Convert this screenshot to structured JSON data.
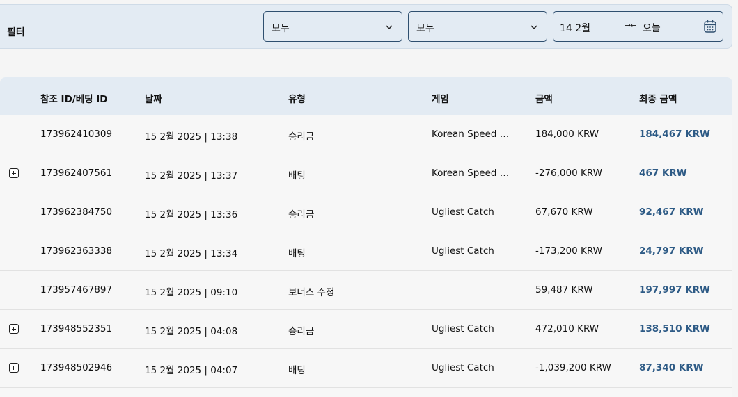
{
  "filter": {
    "title": "필터",
    "select1": "모두",
    "select2": "모두",
    "date_from": "14 2월",
    "date_arrows": "→←",
    "date_to": "오늘"
  },
  "table": {
    "headers": [
      "참조 ID/베팅 ID",
      "날짜",
      "유형",
      "게임",
      "금액",
      "최종 금액"
    ],
    "rows": [
      {
        "expandable": false,
        "ref_id": "173962410309",
        "date": "15 2월 2025 | 13:38",
        "type": "승리금",
        "game": "Korean Speed …",
        "amount": "184,000 KRW",
        "final": "184,467 KRW"
      },
      {
        "expandable": true,
        "ref_id": "173962407561",
        "date": "15 2월 2025 | 13:37",
        "type": "배팅",
        "game": "Korean Speed …",
        "amount": "-276,000 KRW",
        "final": "467 KRW"
      },
      {
        "expandable": false,
        "ref_id": "173962384750",
        "date": "15 2월 2025 | 13:36",
        "type": "승리금",
        "game": "Ugliest Catch",
        "amount": "67,670 KRW",
        "final": "92,467 KRW"
      },
      {
        "expandable": false,
        "ref_id": "173962363338",
        "date": "15 2월 2025 | 13:34",
        "type": "배팅",
        "game": "Ugliest Catch",
        "amount": "-173,200 KRW",
        "final": "24,797 KRW"
      },
      {
        "expandable": false,
        "ref_id": "173957467897",
        "date": "15 2월 2025 | 09:10",
        "type": "보너스 수정",
        "game": "",
        "amount": "59,487 KRW",
        "final": "197,997 KRW"
      },
      {
        "expandable": true,
        "ref_id": "173948552351",
        "date": "15 2월 2025 | 04:08",
        "type": "승리금",
        "game": "Ugliest Catch",
        "amount": "472,010 KRW",
        "final": "138,510 KRW"
      },
      {
        "expandable": true,
        "ref_id": "173948502946",
        "date": "15 2월 2025 | 04:07",
        "type": "배팅",
        "game": "Ugliest Catch",
        "amount": "-1,039,200 KRW",
        "final": "87,340 KRW"
      }
    ]
  },
  "colors": {
    "header_bg": "#e3ebf3",
    "final_amount": "#2e5b86",
    "select_border": "#2f4f6f"
  }
}
